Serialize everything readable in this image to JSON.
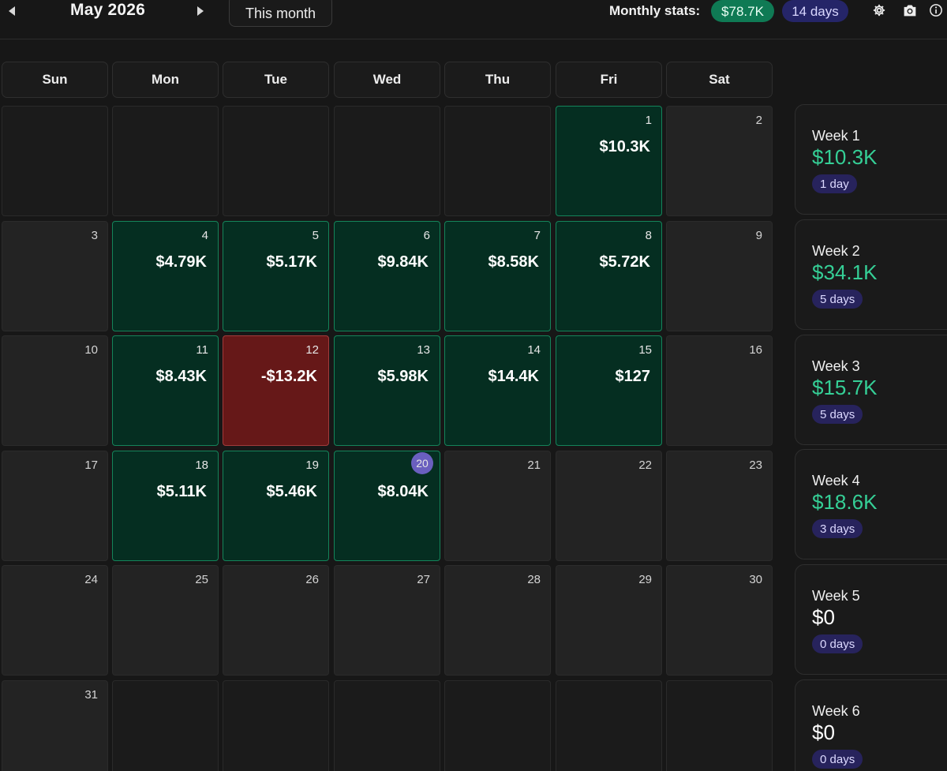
{
  "header": {
    "month_title": "May 2026",
    "this_month_label": "This month",
    "stats_label": "Monthly stats:",
    "stats_amount": "$78.7K",
    "stats_days": "14 days"
  },
  "colors": {
    "profit_bg": "#052e21",
    "loss_bg": "#661818",
    "positive_text": "#35cf96",
    "amount_pill": "#0f7a54",
    "days_pill": "#252568",
    "today_badge": "#6a5fbf"
  },
  "icons": {
    "prev": "triangle-left-icon",
    "next": "triangle-right-icon",
    "settings": "gear-icon",
    "screenshot": "camera-icon",
    "info": "info-icon"
  },
  "weekdays": [
    "Sun",
    "Mon",
    "Tue",
    "Wed",
    "Thu",
    "Fri",
    "Sat"
  ],
  "today": 20,
  "days": [
    {
      "day": "",
      "pnl": "",
      "status": "empty"
    },
    {
      "day": "",
      "pnl": "",
      "status": "empty"
    },
    {
      "day": "",
      "pnl": "",
      "status": "empty"
    },
    {
      "day": "",
      "pnl": "",
      "status": "empty"
    },
    {
      "day": "",
      "pnl": "",
      "status": "empty"
    },
    {
      "day": "1",
      "pnl": "$10.3K",
      "status": "profit"
    },
    {
      "day": "2",
      "pnl": "",
      "status": "none"
    },
    {
      "day": "3",
      "pnl": "",
      "status": "none"
    },
    {
      "day": "4",
      "pnl": "$4.79K",
      "status": "profit"
    },
    {
      "day": "5",
      "pnl": "$5.17K",
      "status": "profit"
    },
    {
      "day": "6",
      "pnl": "$9.84K",
      "status": "profit"
    },
    {
      "day": "7",
      "pnl": "$8.58K",
      "status": "profit"
    },
    {
      "day": "8",
      "pnl": "$5.72K",
      "status": "profit"
    },
    {
      "day": "9",
      "pnl": "",
      "status": "none"
    },
    {
      "day": "10",
      "pnl": "",
      "status": "none"
    },
    {
      "day": "11",
      "pnl": "$8.43K",
      "status": "profit"
    },
    {
      "day": "12",
      "pnl": "-$13.2K",
      "status": "loss"
    },
    {
      "day": "13",
      "pnl": "$5.98K",
      "status": "profit"
    },
    {
      "day": "14",
      "pnl": "$14.4K",
      "status": "profit"
    },
    {
      "day": "15",
      "pnl": "$127",
      "status": "profit"
    },
    {
      "day": "16",
      "pnl": "",
      "status": "none"
    },
    {
      "day": "17",
      "pnl": "",
      "status": "none"
    },
    {
      "day": "18",
      "pnl": "$5.11K",
      "status": "profit"
    },
    {
      "day": "19",
      "pnl": "$5.46K",
      "status": "profit"
    },
    {
      "day": "20",
      "pnl": "$8.04K",
      "status": "profit"
    },
    {
      "day": "21",
      "pnl": "",
      "status": "none"
    },
    {
      "day": "22",
      "pnl": "",
      "status": "none"
    },
    {
      "day": "23",
      "pnl": "",
      "status": "none"
    },
    {
      "day": "24",
      "pnl": "",
      "status": "none"
    },
    {
      "day": "25",
      "pnl": "",
      "status": "none"
    },
    {
      "day": "26",
      "pnl": "",
      "status": "none"
    },
    {
      "day": "27",
      "pnl": "",
      "status": "none"
    },
    {
      "day": "28",
      "pnl": "",
      "status": "none"
    },
    {
      "day": "29",
      "pnl": "",
      "status": "none"
    },
    {
      "day": "30",
      "pnl": "",
      "status": "none"
    },
    {
      "day": "31",
      "pnl": "",
      "status": "none"
    },
    {
      "day": "",
      "pnl": "",
      "status": "empty"
    },
    {
      "day": "",
      "pnl": "",
      "status": "empty"
    },
    {
      "day": "",
      "pnl": "",
      "status": "empty"
    },
    {
      "day": "",
      "pnl": "",
      "status": "empty"
    },
    {
      "day": "",
      "pnl": "",
      "status": "empty"
    },
    {
      "day": "",
      "pnl": "",
      "status": "empty"
    }
  ],
  "weeks": [
    {
      "label": "Week 1",
      "value": "$10.3K",
      "days": "1 day",
      "positive": true
    },
    {
      "label": "Week 2",
      "value": "$34.1K",
      "days": "5 days",
      "positive": true
    },
    {
      "label": "Week 3",
      "value": "$15.7K",
      "days": "5 days",
      "positive": true
    },
    {
      "label": "Week 4",
      "value": "$18.6K",
      "days": "3 days",
      "positive": true
    },
    {
      "label": "Week 5",
      "value": "$0",
      "days": "0 days",
      "positive": false
    },
    {
      "label": "Week 6",
      "value": "$0",
      "days": "0 days",
      "positive": false
    }
  ]
}
